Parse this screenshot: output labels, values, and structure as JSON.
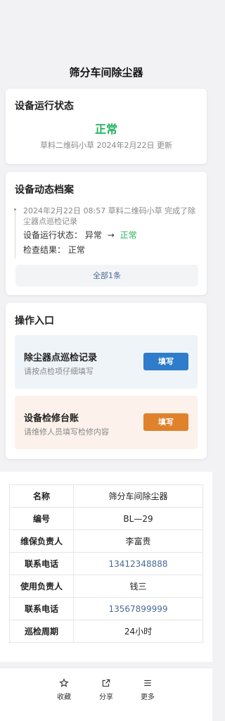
{
  "page": {
    "title": "筛分车间除尘器"
  },
  "status_card": {
    "title": "设备运行状态",
    "value": "正常",
    "value_color": "#22b35e",
    "meta": "草料二维码小草 2024年2月22日 更新"
  },
  "archive_card": {
    "title": "设备动态档案",
    "entry": {
      "header": "2024年2月22日 08:57 草料二维码小草 完成了除尘器点巡检记录",
      "status_label": "设备运行状态：",
      "status_from": "异常",
      "status_to": "正常",
      "result_label": "检查结果：",
      "result_value": "正常"
    },
    "all_button": "全部1条"
  },
  "ops_card": {
    "title": "操作入口",
    "items": [
      {
        "title": "除尘器点巡检记录",
        "subtitle": "请按点检项仔细填写",
        "button": "填写",
        "color": "#2f7ccb"
      },
      {
        "title": "设备检修台账",
        "subtitle": "请维修人员填写检修内容",
        "button": "填写",
        "color": "#e0812c"
      }
    ]
  },
  "info_table": {
    "rows": [
      {
        "key": "名称",
        "value": "筛分车间除尘器"
      },
      {
        "key": "编号",
        "value": "BL—29"
      },
      {
        "key": "维保负责人",
        "value": "李富贵"
      },
      {
        "key": "联系电话",
        "value": "13412348888"
      },
      {
        "key": "使用负责人",
        "value": "钱三"
      },
      {
        "key": "联系电话",
        "value": "13567899999"
      },
      {
        "key": "巡检周期",
        "value": "24小时"
      }
    ]
  },
  "bottom_bar": {
    "items": [
      {
        "label": "收藏",
        "icon": "star-icon"
      },
      {
        "label": "分享",
        "icon": "share-icon"
      },
      {
        "label": "更多",
        "icon": "menu-icon"
      }
    ]
  }
}
